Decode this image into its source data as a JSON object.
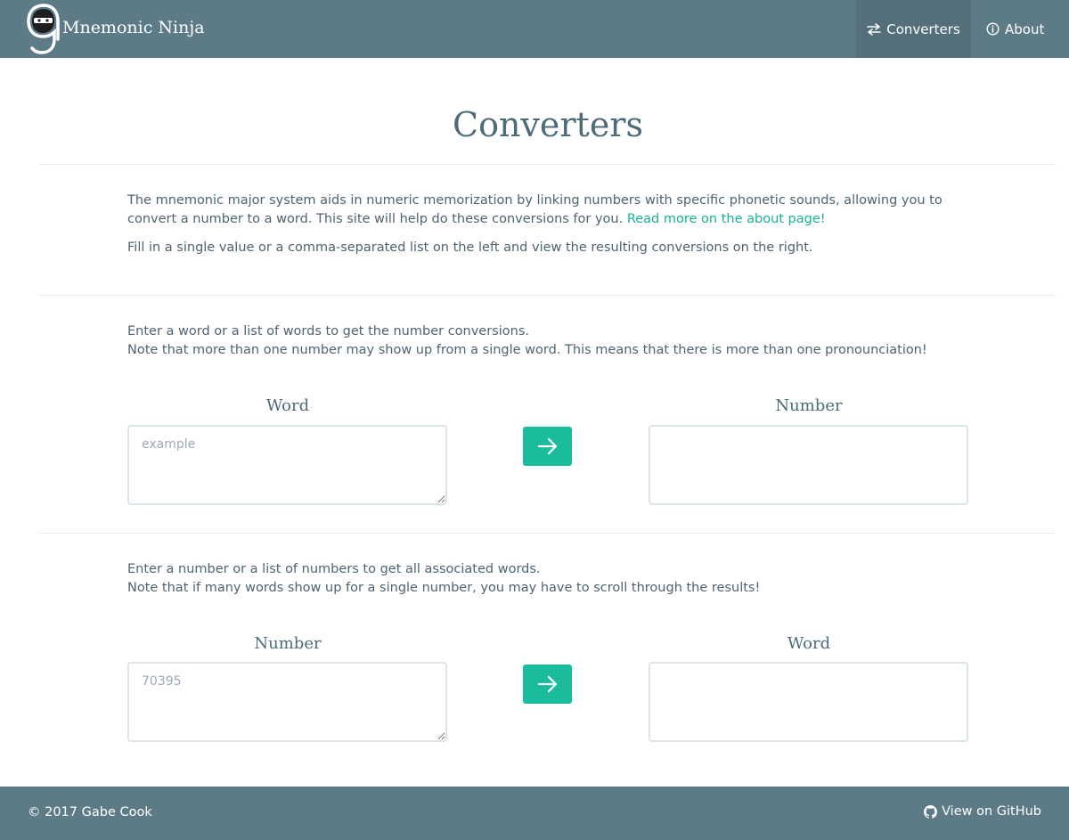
{
  "nav": {
    "brand": "Mnemonic Ninja",
    "items": [
      {
        "label": "Converters",
        "icon": "swap-arrows-icon"
      },
      {
        "label": "About",
        "icon": "info-circle-icon"
      }
    ]
  },
  "page": {
    "title": "Converters",
    "intro": {
      "text": "The mnemonic major system aids in numeric memorization by linking numbers with specific phonetic sounds, allowing you to convert a number to a word. This site will help do these conversions for you. ",
      "link": "Read more on the about page!",
      "instruction": "Fill in a single value or a comma-separated list on the left and view the resulting conversions on the right."
    }
  },
  "word_to_number": {
    "line1": "Enter a word or a list of words to get the number conversions.",
    "line2": "Note that more than one number may show up from a single word. This means that there is more than one pronounciation!",
    "input_label": "Word",
    "output_label": "Number",
    "input_placeholder": "example",
    "input_value": "",
    "output_value": ""
  },
  "number_to_word": {
    "line1": "Enter a number or a list of numbers to get all associated words.",
    "line2": "Note that if many words show up for a single number, you may have to scroll through the results!",
    "input_label": "Number",
    "output_label": "Word",
    "input_placeholder": "70395",
    "input_value": "",
    "output_value": ""
  },
  "footer": {
    "copyright": "© 2017 Gabe Cook",
    "github": "View on GitHub"
  },
  "colors": {
    "navbar": "#5c7b87",
    "accent": "#1abc9c",
    "link": "#17b395",
    "heading": "#4d6b78"
  }
}
